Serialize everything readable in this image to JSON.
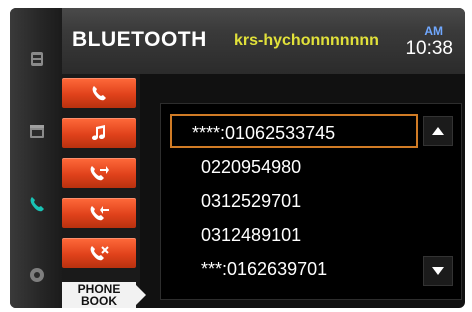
{
  "header": {
    "title": "BLUETOOTH",
    "device_name": "krs-hychonnnnnnn",
    "ampm": "AM",
    "time": "10:38"
  },
  "left_rail": {
    "icons": [
      "media-icon",
      "calendar-icon",
      "phone-icon",
      "settings-icon"
    ],
    "active_color": "#19c3b5"
  },
  "sidebar": {
    "buttons": [
      "phone-icon",
      "music-note-icon",
      "outgoing-call-icon",
      "incoming-call-icon",
      "missed-call-icon"
    ],
    "phonebook_label_line1": "PHONE",
    "phonebook_label_line2": "BOOK"
  },
  "list": {
    "items": [
      "****:01062533745",
      "0220954980",
      "0312529701",
      "0312489101",
      "***:0162639701"
    ],
    "selected_index": 0,
    "up_icon": "triangle-up-icon",
    "down_icon": "triangle-down-icon"
  },
  "colors": {
    "accent_orange": "#e0421b",
    "selection_border": "#d07b25",
    "device_name_yellow": "#e1e13a",
    "ampm_blue": "#70a8ff"
  }
}
